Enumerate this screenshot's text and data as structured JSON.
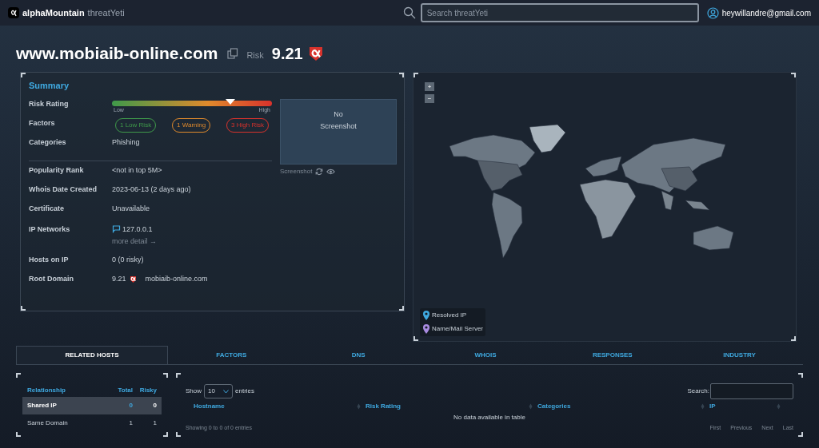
{
  "header": {
    "logo_brand": "alphaMountain",
    "logo_product": "threatYeti",
    "search": {
      "placeholder": "Search threatYeti"
    },
    "user": "heywillandre@gmail.com"
  },
  "domain": {
    "name": "www.mobiaib-online.com",
    "risk_label": "Risk",
    "score": "9.21"
  },
  "summary": {
    "title": "Summary",
    "risk_rating": {
      "label": "Risk Rating",
      "level": 0.74,
      "low": "Low",
      "high": "High"
    },
    "factors": {
      "label": "Factors",
      "chips": [
        {
          "text": "1 Low Risk",
          "color": "#3f9a4a"
        },
        {
          "text": "1 Warning",
          "color": "#e08a2c"
        },
        {
          "text": "3 High Risk",
          "color": "#d8322c"
        }
      ]
    },
    "categories": {
      "label": "Categories",
      "value": "Phishing"
    },
    "rows": [
      {
        "kind": "text",
        "label": "Popularity Rank",
        "value": "<not in top 5M>"
      },
      {
        "kind": "text",
        "label": "Whois Date Created",
        "value": "2023-06-13 (2 days ago)"
      },
      {
        "kind": "text",
        "label": "Certificate",
        "value": "Unavailable"
      },
      {
        "kind": "ip",
        "label": "IP Networks",
        "value": "127.0.0.1",
        "link": "more detail →"
      },
      {
        "kind": "text",
        "label": "Hosts on IP",
        "value": "0 (0 risky)"
      },
      {
        "kind": "domain",
        "label": "Root Domain",
        "score": "9.21",
        "value": "mobiaib-online.com"
      }
    ],
    "screenshot": {
      "message_line1": "No",
      "message_line2": "Screenshot",
      "caption": "Screenshot"
    }
  },
  "map": {
    "zoom_in": "+",
    "zoom_out": "−",
    "legend": [
      {
        "text": "Resolved IP",
        "color": "#3fa9e0"
      },
      {
        "text": "Name/Mail Server",
        "color": "#a98be0"
      }
    ]
  },
  "tabs": [
    {
      "label": "RELATED HOSTS",
      "selected": true
    },
    {
      "label": "FACTORS",
      "selected": false
    },
    {
      "label": "DNS",
      "selected": false
    },
    {
      "label": "WHOIS",
      "selected": false
    },
    {
      "label": "RESPONSES",
      "selected": false
    },
    {
      "label": "INDUSTRY",
      "selected": false
    }
  ],
  "relationships": {
    "columns": [
      "Relationship",
      "Total",
      "Risky"
    ],
    "rows": [
      {
        "name": "Shared IP",
        "total": "0",
        "risky": "0",
        "selected": true
      },
      {
        "name": "Same Domain",
        "total": "1",
        "risky": "1",
        "selected": false
      }
    ]
  },
  "hosts_table": {
    "show": "Show",
    "page_size": "10",
    "entries": "entries",
    "search_label": "Search:",
    "columns": [
      "Hostname",
      "Risk Rating",
      "Categories",
      "IP"
    ],
    "empty": "No data available in table",
    "info": "Showing 0 to 0 of 0 entries",
    "pagination": [
      "First",
      "Previous",
      "Next",
      "Last"
    ]
  }
}
